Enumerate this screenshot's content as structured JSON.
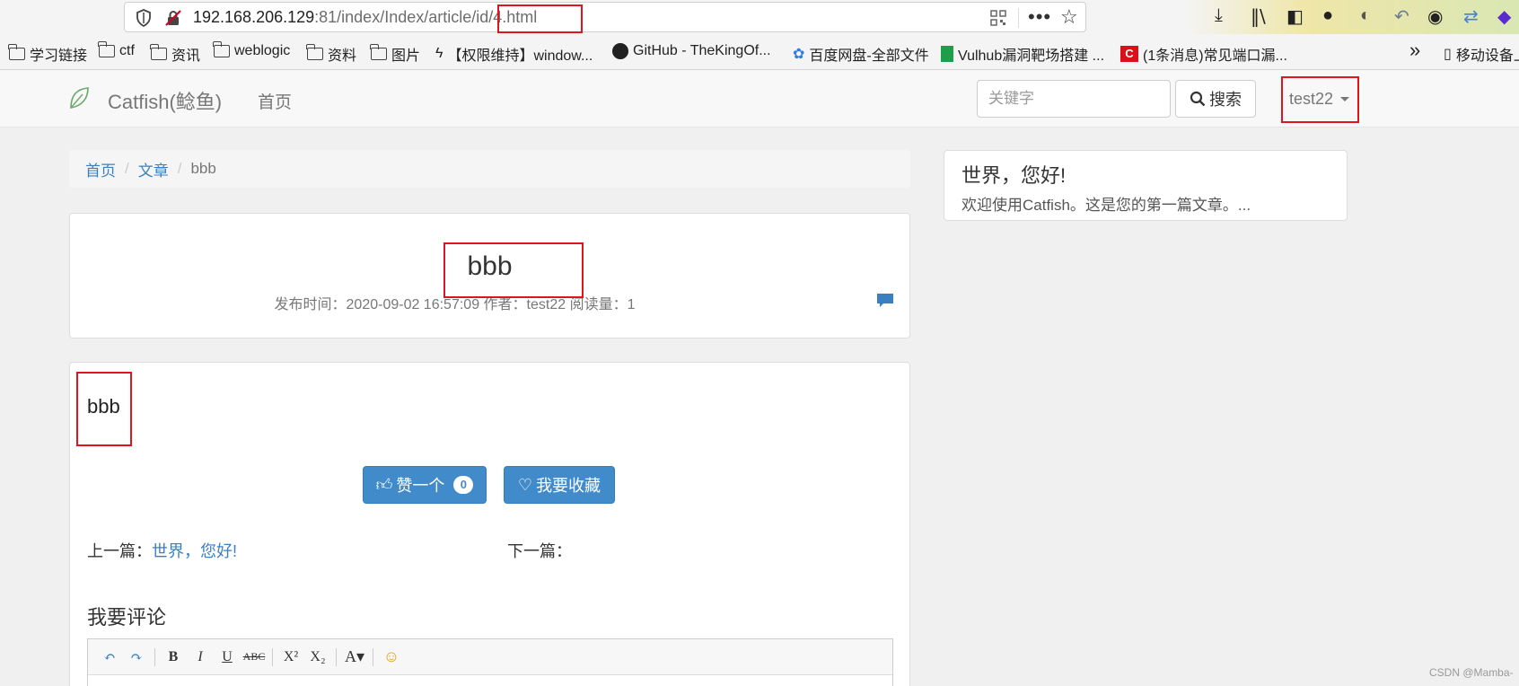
{
  "browser": {
    "url_host": "192.168.206.129",
    "url_rest": ":81/index/Index/article/id/4.html",
    "bookmarks": [
      {
        "label": "学习链接",
        "icon": "folder-icon"
      },
      {
        "label": "ctf",
        "icon": "folder-icon"
      },
      {
        "label": "资讯",
        "icon": "folder-icon"
      },
      {
        "label": "weblogic",
        "icon": "folder-icon"
      },
      {
        "label": "资料",
        "icon": "folder-icon"
      },
      {
        "label": "图片",
        "icon": "folder-icon"
      },
      {
        "label": "【权限维持】window...",
        "icon": "site-icon"
      },
      {
        "label": "GitHub - TheKingOf...",
        "icon": "github-icon"
      },
      {
        "label": "百度网盘-全部文件",
        "icon": "baidu-icon"
      },
      {
        "label": "Vulhub漏洞靶场搭建 ...",
        "icon": "vulhub-icon"
      },
      {
        "label": "(1条消息)常见端口漏...",
        "icon": "csdn-icon"
      }
    ],
    "overflow_label": "»",
    "mobile_label": "移动设备上"
  },
  "navbar": {
    "brand": "Catfish(鲶鱼)",
    "home": "首页",
    "search_placeholder": "关键字",
    "search_button": "搜索",
    "user": "test22"
  },
  "breadcrumb": {
    "home": "首页",
    "articles": "文章",
    "current": "bbb"
  },
  "article": {
    "title": "bbb",
    "meta": "发布时间：2020-09-02 16:57:09 作者：test22 阅读量：1",
    "body": "bbb",
    "like_label": "赞一个",
    "like_count": "0",
    "favorite_label": "我要收藏",
    "prev_prefix": "上一篇：",
    "prev_link": "世界，您好!",
    "next_prefix": "下一篇：",
    "comment_heading": "我要评论"
  },
  "sidebar": {
    "title": "世界，您好!",
    "desc": "欢迎使用Catfish。这是您的第一篇文章。..."
  },
  "editor_tools": [
    "undo-icon",
    "redo-icon",
    "bold-icon",
    "italic-icon",
    "underline-icon",
    "strikethrough-icon",
    "superscript-icon",
    "subscript-icon",
    "font-color-icon",
    "emoji-icon"
  ],
  "colors": {
    "link": "#3a7fc2",
    "primary": "#428bca",
    "highlight": "#e0141e"
  },
  "watermark": "CSDN @Mamba-"
}
